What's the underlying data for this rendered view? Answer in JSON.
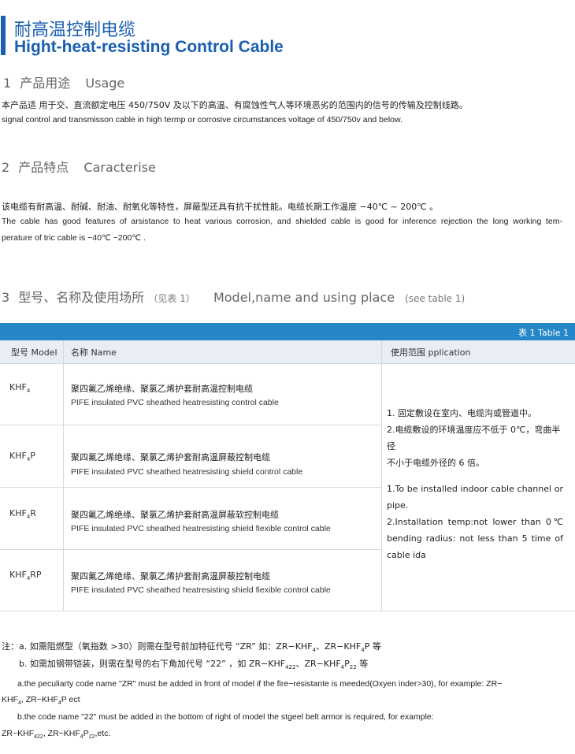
{
  "header": {
    "title_cn": "耐高温控制电缆",
    "title_en": "Hight-heat-resisting Control Cable"
  },
  "sections": [
    {
      "number": "1",
      "title_cn": "产品用途",
      "title_en": "Usage"
    },
    {
      "number": "2",
      "title_cn": "产品特点",
      "title_en": "Caracterise"
    },
    {
      "number": "3",
      "title_cn": "型号、名称及使用场所",
      "note_cn": "（见表 1）",
      "title_en": "Model,name and using place",
      "note_en": "(see table 1)"
    }
  ],
  "usage": {
    "cn": "本产品适 用于交、直流额定电压 450/750V 及以下的高温、有腐蚀性气人等环境恶劣的范围内的信号的传输及控制线路。",
    "en": "signal control and transmisson cable in high termp or corrosive circumstances voltage of 450/750v and below."
  },
  "features": {
    "cn": "该电缆有耐高温、耐碱、耐油、耐氧化等特性，屏蔽型还具有抗干扰性能。电缆长期工作温度 −40℃ ~ 200℃ 。",
    "en_line1": "The cable has good features of arsistance to heat various corrosion, and shielded cable is good for inference rejection the long working tem-",
    "en_line2": "perature of tric cable is −40℃ −200℃ ."
  },
  "table": {
    "caption": "表 1  Table 1",
    "headers": {
      "model": "型号 Model",
      "name": "名称 Name",
      "scope": "使用范围 pplication"
    },
    "rows": [
      {
        "model_base": "KHF",
        "model_sub": "4",
        "model_suffix": "",
        "name_cn": "聚四氟乙烯绝缘、聚氯乙烯护套耐高温控制电缆",
        "name_en": "PIFE insulated PVC sheathed heatresisting control cable"
      },
      {
        "model_base": "KHF",
        "model_sub": "4",
        "model_suffix": "P",
        "name_cn": "聚四氟乙烯绝缘、聚氯乙烯护套耐高温屏蔽控制电缆",
        "name_en": "PIFE insulated PVC sheathed heatresisting shield control cable"
      },
      {
        "model_base": "KHF",
        "model_sub": "4",
        "model_suffix": "R",
        "name_cn": "聚四氟乙烯绝缘、聚氯乙烯护套耐高温屏蔽软控制电缆",
        "name_en": "PIFE insulated PVC sheathed heatresisting shield fiexible control cable"
      },
      {
        "model_base": "KHF",
        "model_sub": "4",
        "model_suffix": "RP",
        "name_cn": "聚四氟乙烯绝缘、聚氯乙烯护套耐高温屏蔽控制电缆",
        "name_en": "PIFE insulated PVC sheathed heatresisting shield fiexible control cable"
      }
    ],
    "scope": {
      "cn_1": "1. 固定敷设在室内、电缆沟或管道中。",
      "cn_2a": "2.电缆敷设的环境温度应不低于 0℃，弯曲半径",
      "cn_2b": "不小于电缆外径的 6 倍。",
      "en_1a": "1.To be installed indoor cable channel or",
      "en_1b": "pipe.",
      "en_2a": "2.Installation temp:not lower than 0℃",
      "en_2b": "bending radius: not less than 5 time of",
      "en_2c": "cable ida"
    }
  },
  "notes": {
    "label": "注：",
    "a_cn": "a. 如需阻燃型（氧指数 >30）则需在型号前加特征代号 “ZR” 如：ZR−KHF",
    "a_cn_mid": "、ZR−KHF",
    "a_cn_end": "P 等",
    "b_cn": "b. 如需加钢带铠装，则需在型号的右下角加代号 “22” ，如 ZR−KHF",
    "b_cn_mid": "、ZR−KHF",
    "b_cn_mid2": "P",
    "b_cn_end": " 等",
    "a_en_1": "a.the peculiarty code name \"ZR\" must be added in front of model if the fire−resistante is meeded(Oxyen inder>30), for example: ZR−",
    "a_en_2a": "KHF",
    "a_en_2b": ", ZR−KHF",
    "a_en_2c": "P ect",
    "b_en_1": "b.the code name \"22\" must be added in the bottom of right of model the stgeel belt armor is required, for example:",
    "b_en_2a": "ZR−KHF",
    "b_en_2b": ", ZR−KHF",
    "b_en_2c": "P",
    "b_en_2d": ",etc.",
    "sub_4": "4",
    "sub_422": "422",
    "sub_22": "22"
  }
}
